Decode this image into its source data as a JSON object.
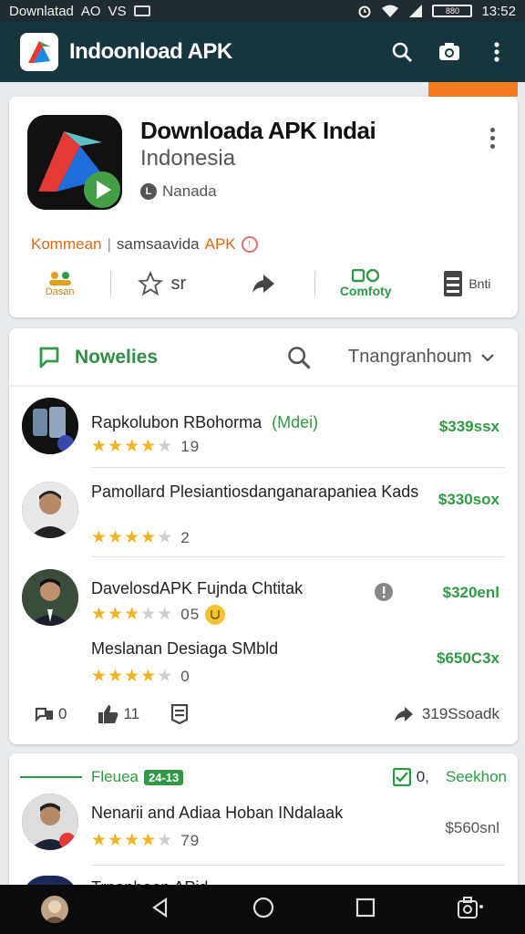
{
  "status_bar": {
    "left_text": "Downlatad",
    "mid_text": "AO",
    "mid_text2": "VS",
    "time": "13:52",
    "battery": "880"
  },
  "app_bar": {
    "title": "Indoonload APK"
  },
  "app_card": {
    "name": "Downloada APK Indai",
    "subtitle": "Indonesia",
    "author": "Nanada",
    "comment_label": "Kommean",
    "comment_text": "samsaavida",
    "comment_apk": "APK",
    "actions": [
      {
        "label": "Dasan",
        "icon": "people-icon"
      },
      {
        "label": "sr",
        "icon": "star-outline-icon"
      },
      {
        "label": "",
        "icon": "share-arrow-icon"
      },
      {
        "label": "Comfoty",
        "icon": "compat-icon"
      },
      {
        "label": "Bnti",
        "icon": "storage-icon"
      }
    ]
  },
  "list_card": {
    "tab_label": "Nowelies",
    "sort_label": "Tnangranhoum",
    "items": [
      {
        "title": "Rapkolubon RBohorma",
        "tag": "(Mdei)",
        "price": "$339ssx",
        "rating": 4,
        "count": "19"
      },
      {
        "title": "Pamollard Plesiantiosdanganarapaniea Kads",
        "tag": "",
        "price": "$330sox",
        "rating": 4,
        "count": "2"
      },
      {
        "title": "DavelosdAPK Fujnda Chtitak",
        "tag": "",
        "price": "$320enl",
        "rating": 3,
        "count": "05"
      },
      {
        "title": "Meslanan Desiaga SMbld",
        "tag": "",
        "price": "$650C3x",
        "rating": 4,
        "count": "0"
      }
    ],
    "bottom_actions": {
      "comments": "0",
      "likes": "11",
      "share_text": "319Ssoadk"
    }
  },
  "news_card": {
    "label": "Fleuea",
    "tag": "24-13",
    "count": "0,",
    "search_label": "Seekhon",
    "item": {
      "title": "Nenarii and Adiaa Hoban INdalaak",
      "price": "$560snl",
      "rating": 4,
      "count": "79"
    },
    "next_title": "Trnanhoon APid"
  },
  "colors": {
    "app_bar": "#16353f",
    "accent_green": "#2f9a46",
    "accent_orange": "#f57c1f",
    "star": "#f3b321"
  }
}
